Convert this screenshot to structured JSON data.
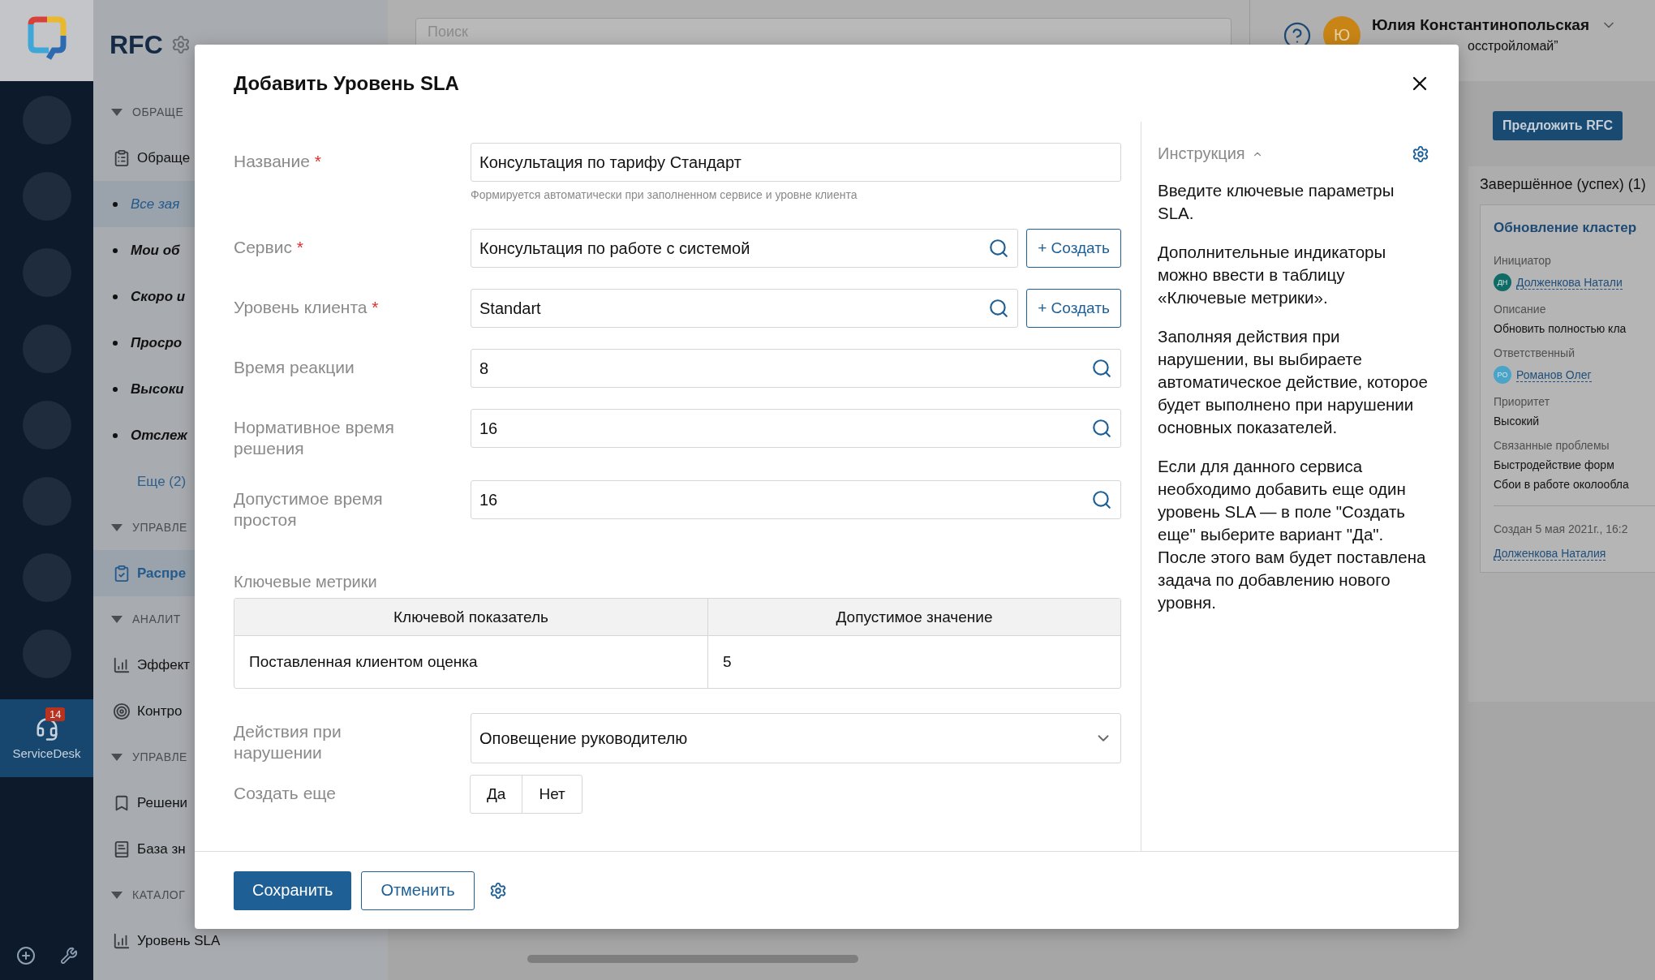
{
  "service_desk": {
    "label": "ServiceDesk",
    "badge": "14",
    "selected": true
  },
  "sidebar": {
    "title": "RFC",
    "sections": [
      {
        "title": "ОБРАЩЕ",
        "expanded": true,
        "items": [
          {
            "label": "Обраще",
            "kind": "page",
            "selected": false
          },
          {
            "label": "Все зая",
            "kind": "filter",
            "selected": true
          },
          {
            "label": "Мои об",
            "kind": "filter",
            "selected": false
          },
          {
            "label": "Скоро и",
            "kind": "filter",
            "selected": false
          },
          {
            "label": "Просро",
            "kind": "filter",
            "selected": false
          },
          {
            "label": "Высоки",
            "kind": "filter",
            "selected": false
          },
          {
            "label": "Отслеж",
            "kind": "filter",
            "selected": false
          },
          {
            "label": "Еще (2)",
            "kind": "more",
            "selected": false
          }
        ]
      },
      {
        "title": "УПРАВЛЕ",
        "expanded": true,
        "items": [
          {
            "label": "Распре",
            "kind": "page",
            "selected": true
          }
        ]
      },
      {
        "title": "АНАЛИТ",
        "expanded": true,
        "items": [
          {
            "label": "Эффект",
            "kind": "page",
            "selected": false
          },
          {
            "label": "Контро",
            "kind": "page",
            "selected": false
          }
        ]
      },
      {
        "title": "УПРАВЛЕ",
        "expanded": true,
        "items": [
          {
            "label": "Решени",
            "kind": "page",
            "selected": false
          },
          {
            "label": "База зн",
            "kind": "page",
            "selected": false
          }
        ]
      },
      {
        "title": "КАТАЛОГ",
        "expanded": true,
        "items": [
          {
            "label": "Уровень SLA",
            "kind": "page",
            "selected": false
          }
        ]
      }
    ]
  },
  "header": {
    "search": {
      "placeholder": "Поиск"
    },
    "user": {
      "initial": "Ю",
      "name": "Юлия Константинопольская",
      "org": "осстройломай”"
    }
  },
  "board": {
    "propose_button": "Предложить RFC",
    "column_title": "Завершённое (успех) (1)",
    "card": {
      "title": "Обновление кластер",
      "fields": [
        {
          "label": "Инициатор",
          "kind": "person",
          "initials": "ДН",
          "color": "#0e6b66",
          "value": "Долженкова Натали"
        },
        {
          "label": "Описание",
          "kind": "text",
          "value": "Обновить полностью кла"
        },
        {
          "label": "Ответственный",
          "kind": "person",
          "initials": "РО",
          "color": "#4aa3c8",
          "value": "Романов Олег"
        },
        {
          "label": "Приоритет",
          "kind": "text",
          "value": "Высокий"
        },
        {
          "label": "Связанные проблемы",
          "kind": "list",
          "values": [
            "Быстродействие форм",
            "Сбои в работе околообла"
          ]
        }
      ],
      "created": "Создан 5 мая 2021г., 16:2",
      "author": "Долженкова Наталия"
    }
  },
  "modal": {
    "title": "Добавить Уровень SLA",
    "required_mark": "*",
    "fields": [
      {
        "label": "Название",
        "required": true,
        "kind": "text",
        "value": "Консультация по тарифу Стандарт",
        "hint": "Формируется автоматически при заполненном сервисе и уровне клиента"
      },
      {
        "label": "Сервис",
        "required": true,
        "kind": "lookup",
        "value": "Консультация по работе с системой",
        "create": "+ Создать"
      },
      {
        "label": "Уровень клиента",
        "required": true,
        "kind": "lookup",
        "value": "Standart",
        "create": "+ Создать"
      },
      {
        "label": "Время реакции",
        "required": false,
        "kind": "lookup",
        "value": "8"
      },
      {
        "label": "Нормативное время решения",
        "required": false,
        "kind": "lookup",
        "value": "16"
      },
      {
        "label": "Допустимое время простоя",
        "required": false,
        "kind": "lookup",
        "value": "16"
      }
    ],
    "metrics": {
      "title": "Ключевые метрики",
      "columns": [
        "Ключевой показатель",
        "Допустимое значение"
      ],
      "rows": [
        [
          "Поставленная клиентом оценка",
          "5"
        ]
      ]
    },
    "action": {
      "label": "Действия при нарушении",
      "kind": "select",
      "value": "Оповещение руководителю"
    },
    "create_more": {
      "label": "Создать еще",
      "options": [
        {
          "label": "Да",
          "selected": false
        },
        {
          "label": "Нет",
          "selected": false
        }
      ]
    },
    "instruction": {
      "title": "Инструкция",
      "expanded": true,
      "paragraphs": [
        "Введите ключевые параметры SLA.",
        "Дополнительные индикаторы можно ввести в таблицу «Ключевые метрики».",
        "Заполняя действия при нарушении, вы выбираете автоматическое действие, которое будет выполнено при нарушении основных показателей.",
        "Если для данного сервиса необходимо добавить еще один уровень SLA — в поле \"Создать еще\" выберите вариант \"Да\". После этого вам будет поставлена задача по добавлению нового уровня."
      ]
    },
    "footer": {
      "save": "Сохранить",
      "cancel": "Отменить"
    }
  }
}
